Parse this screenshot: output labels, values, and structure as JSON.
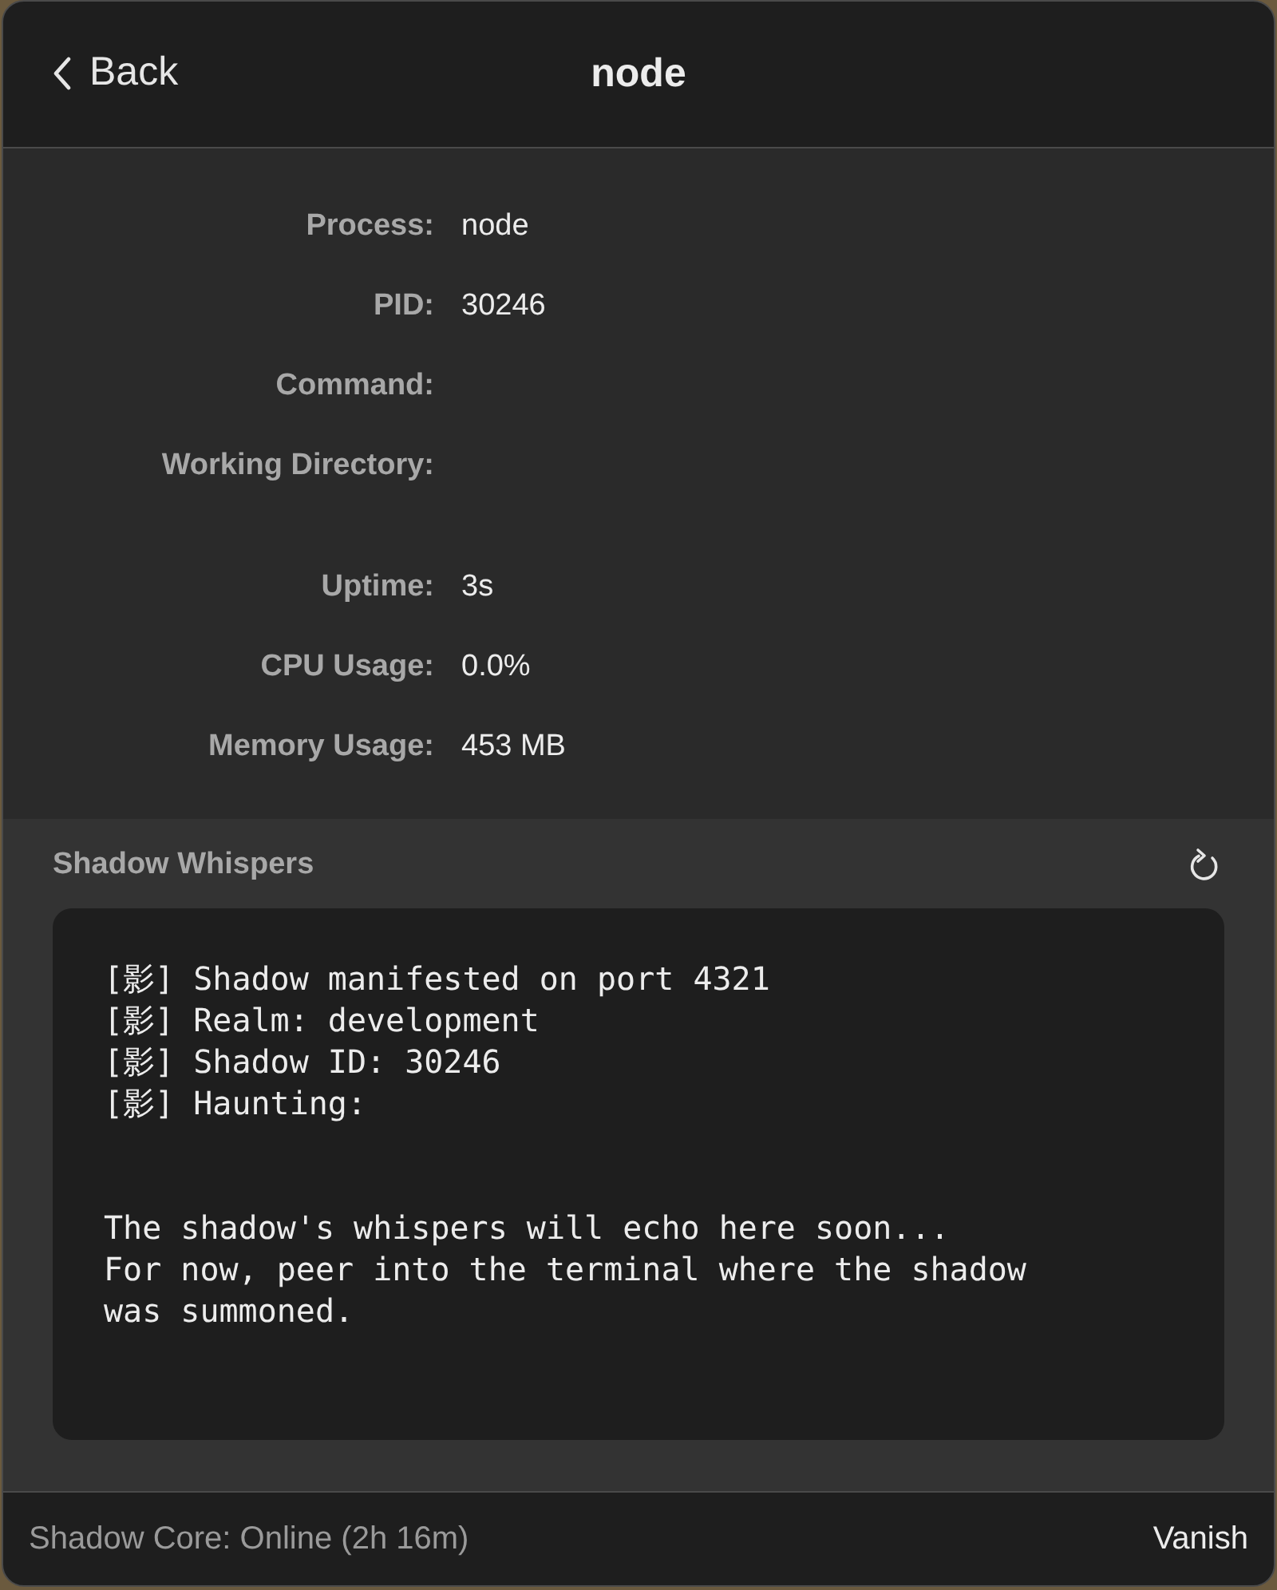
{
  "header": {
    "back_label": "Back",
    "title": "node"
  },
  "info_groups": [
    {
      "rows": [
        {
          "label": "Process:",
          "value": "node"
        },
        {
          "label": "PID:",
          "value": "30246"
        },
        {
          "label": "Command:"
        },
        {
          "label": "Working Directory:"
        }
      ]
    },
    {
      "rows": [
        {
          "label": "Uptime:",
          "value": "3s"
        },
        {
          "label": "CPU Usage:",
          "value": "0.0%"
        },
        {
          "label": "Memory Usage:",
          "value": "453 MB"
        }
      ]
    }
  ],
  "whispers": {
    "title": "Shadow Whispers",
    "log_lines": [
      "[影] Shadow manifested on port 4321",
      "[影] Realm: development",
      "[影] Shadow ID: 30246",
      "[影] Haunting:"
    ],
    "message": [
      "The shadow's whispers will echo here soon...",
      "For now, peer into the terminal where the shadow was summoned."
    ]
  },
  "status_bar": {
    "status": "Shadow Core: Online (2h 16m)",
    "action": "Vanish"
  }
}
